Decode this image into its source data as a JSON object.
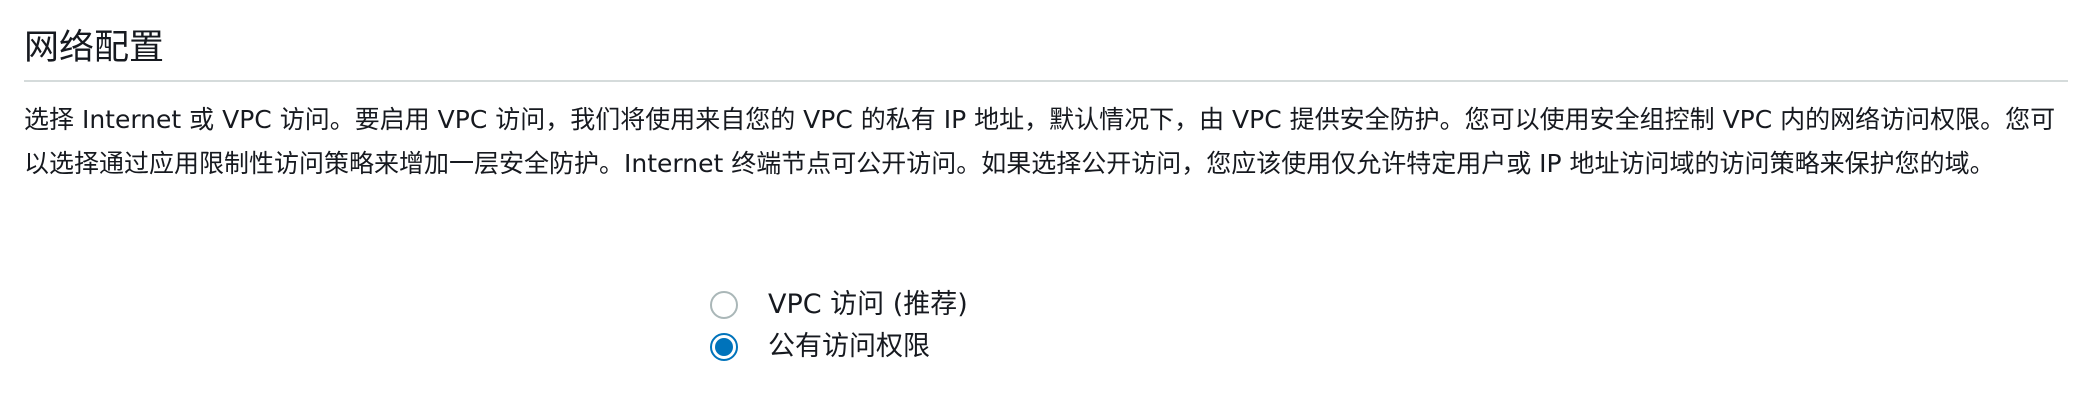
{
  "section": {
    "title": "网络配置",
    "description": "选择 Internet 或 VPC 访问。要启用 VPC 访问，我们将使用来自您的 VPC 的私有 IP 地址，默认情况下，由 VPC 提供安全防护。您可以使用安全组控制 VPC 内的网络访问权限。您可以选择通过应用限制性访问策略来增加一层安全防护。Internet 终端节点可公开访问。如果选择公开访问，您应该使用仅允许特定用户或 IP 地址访问域的访问策略来保护您的域。"
  },
  "network_options": {
    "selected": "公有访问权限",
    "items": [
      {
        "label": "VPC 访问 (推荐)",
        "checked": false
      },
      {
        "label": "公有访问权限",
        "checked": true
      }
    ]
  },
  "colors": {
    "accent": "#0073bb",
    "text": "#16191f",
    "divider": "#d5dbdb",
    "radio_border": "#aab7b8"
  }
}
